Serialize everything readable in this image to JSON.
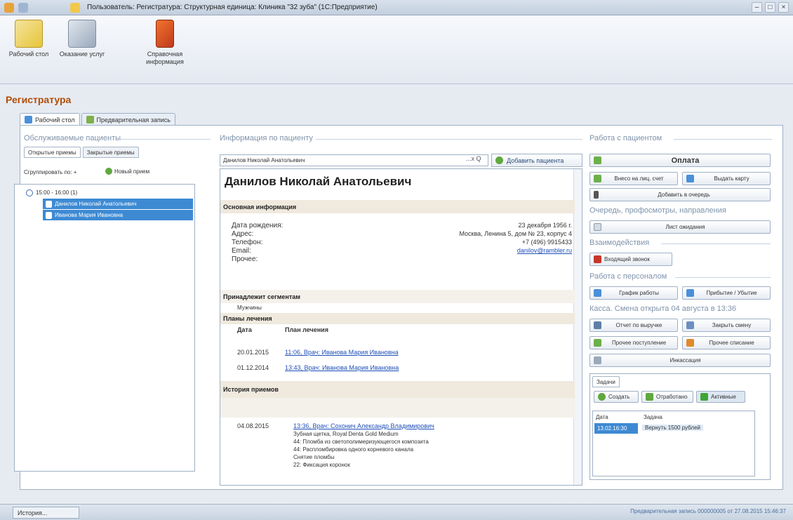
{
  "window": {
    "title": "Пользователь: Регистратура: Структурная единица: Клиника \"32 зуба\" (1С:Предприятие)"
  },
  "sections": [
    {
      "label": "Рабочий стол",
      "icon": "notepad-icon"
    },
    {
      "label": "Оказание услуг",
      "icon": "doctor-icon"
    },
    {
      "label": "Справочная информация",
      "icon": "book-icon"
    }
  ],
  "page": {
    "title": "Регистратура"
  },
  "tabs": [
    {
      "label": "Рабочий стол"
    },
    {
      "label": "Предварительная запись"
    }
  ],
  "left": {
    "group_title": "Обслуживаемые пациенты",
    "subtabs": [
      "Открытые приемы",
      "Закрытые приемы"
    ],
    "group_label": "Сгруппировать по: +",
    "new_label": "Новый прием",
    "time_slot": "15:00 - 16:00 (1)",
    "patients": [
      "Данилов Николай Анатольевич",
      "Иванова Мария Ивановна"
    ]
  },
  "center": {
    "group_title": "Информация по пациенту",
    "search_value": "Данилов Николай Анатольевич",
    "search_btns": "...x Q",
    "add_patient": "Добавить пациента",
    "patient_name": "Данилов Николай Анатольевич",
    "main_info_title": "Основная информация",
    "fields": [
      {
        "label": "Дата рождения:",
        "value": "23 декабря 1956 г."
      },
      {
        "label": "Адрес:",
        "value": "Москва, Ленина 5, дом № 23, корпус 4"
      },
      {
        "label": "Телефон:",
        "value": "+7 (496) 9915433"
      },
      {
        "label": "Email:",
        "value": "danilov@rambler.ru"
      },
      {
        "label": "Прочее:",
        "value": ""
      }
    ],
    "segments_title": "Принадлежит сегментам",
    "segment": "Мужчины",
    "plans_title": "Планы лечения",
    "plans_cols": [
      "Дата",
      "План лечения"
    ],
    "plans": [
      {
        "date": "20.01.2015",
        "plan": "11:06, Врач: Иванова Мария Ивановна"
      },
      {
        "date": "01.12.2014",
        "plan": "13:43, Врач: Иванова Мария Ивановна"
      }
    ],
    "history_title": "История приемов",
    "history": {
      "date": "04.08.2015",
      "link": "13:36, Врач: Сохонич Александр Владимирович",
      "lines": [
        "Зубная щетка, Royal Denta Gold Medium",
        "44: Пломба из светополимеризующегося композита",
        "44: Распломбировка одного корневого канала",
        "Снятие пломбы",
        "22: Фиксация коронок"
      ]
    }
  },
  "right": {
    "patients_title": "Работа с пациентом",
    "pay": "Оплата",
    "deposit": "Внесо на лиц. счет",
    "card": "Выдать карту",
    "queue": "Добавить в очередь",
    "queue_title": "Очередь, профосмотры, направления",
    "sheet": "Лист ожидания",
    "interaction_title": "Взаимодействия",
    "call": "Входящий звонок",
    "staff_title": "Работа с персоналом",
    "schedule": "График работы",
    "arrival": "Прибытие / Убытие",
    "cash_title": "Касса. Смена открыта 04 августа в 13:36",
    "report": "Отчет по выручке",
    "close_shift": "Закрыть смену",
    "income": "Прочее поступление",
    "expense": "Прочее списание",
    "collection": "Инкассация",
    "tasks_tab": "Задачи",
    "create": "Создать",
    "worked": "Отработано",
    "active": "Активные",
    "grid_cols": [
      "Дата",
      "Задача"
    ],
    "task_date": "13.02.16:30",
    "task_text": "Вернуть 1500 рублей"
  },
  "status": {
    "history_btn": "История...",
    "text": "Предварительная запись 000000005 от 27.08.2015 15:46:37"
  }
}
